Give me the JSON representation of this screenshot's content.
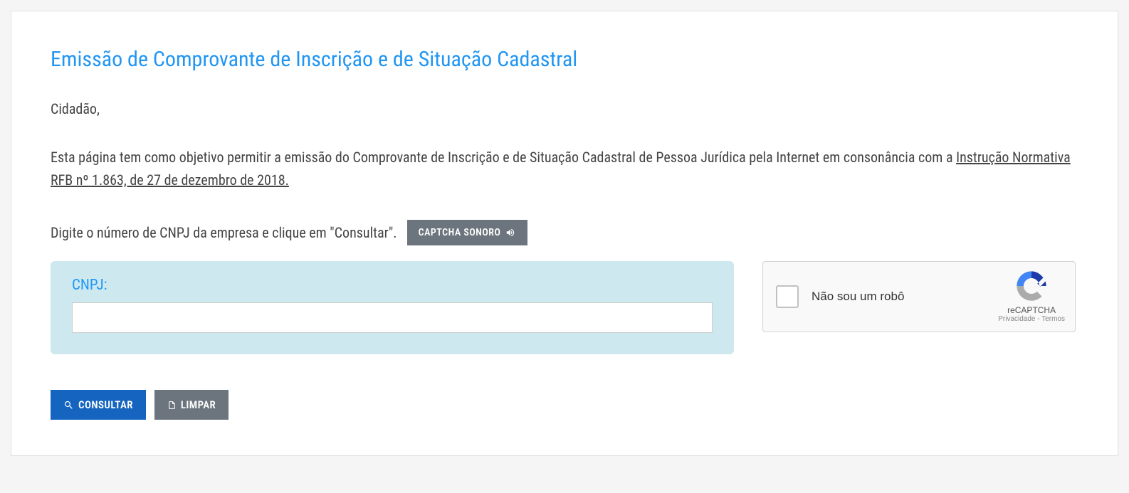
{
  "page": {
    "title": "Emissão de Comprovante de Inscrição e de Situação Cadastral",
    "greeting": "Cidadão,",
    "intro_before_link": "Esta página tem como objetivo permitir a emissão do Comprovante de Inscrição e de Situação Cadastral de Pessoa Jurídica pela Internet em consonância com a ",
    "intro_link_text": "Instrução Normativa RFB nº 1.863, de 27 de dezembro de 2018.",
    "instruction": "Digite o número de CNPJ da empresa e clique em \"Consultar\".",
    "audio_captcha_label": "CAPTCHA SONORO"
  },
  "form": {
    "cnpj_label": "CNPJ:",
    "cnpj_value": ""
  },
  "recaptcha": {
    "checkbox_label": "Não sou um robô",
    "brand": "reCAPTCHA",
    "privacy": "Privacidade",
    "separator": " - ",
    "terms": "Termos"
  },
  "actions": {
    "consultar": "CONSULTAR",
    "limpar": "LIMPAR"
  }
}
